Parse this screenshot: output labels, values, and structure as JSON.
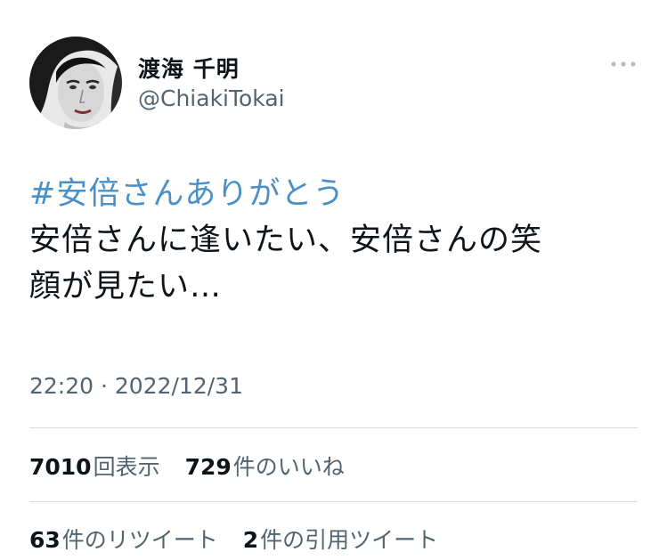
{
  "user": {
    "display_name": "渡海 千明",
    "handle": "@ChiakiTokai",
    "avatar_icon": "profile-photo"
  },
  "tweet": {
    "hashtag": "#安倍さんありがとう",
    "lines": [
      "安倍さんに逢いたい、安倍さんの笑",
      "顔が見たい…"
    ],
    "timestamp": "22:20 · 2022/12/31"
  },
  "stats": {
    "views": {
      "count": "7010",
      "label": "回表示"
    },
    "likes": {
      "count": "729",
      "label": "件のいいね"
    },
    "retweets": {
      "count": "63",
      "label": "件のリツイート"
    },
    "quotes": {
      "count": "2",
      "label": "件の引用ツイート"
    }
  },
  "colors": {
    "hashtag": "#4a90c8",
    "secondary_text": "#536471",
    "divider": "#d9dde1"
  }
}
